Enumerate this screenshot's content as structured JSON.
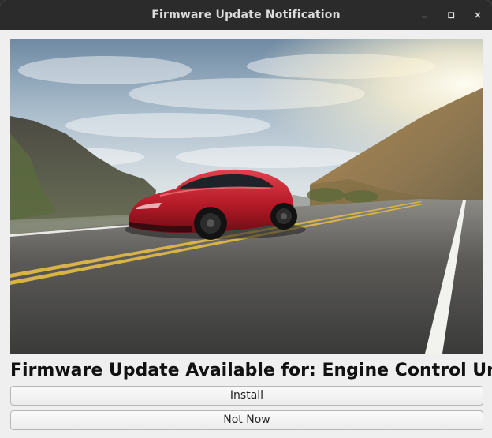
{
  "window": {
    "title": "Firmware Update Notification"
  },
  "icons": {
    "minimize": "minimize-icon",
    "maximize": "maximize-icon",
    "close": "close-icon"
  },
  "content": {
    "image": "red sports car driving on a mountain road",
    "headline": "Firmware Update Available for: Engine Control Unit"
  },
  "actions": {
    "install_label": "Install",
    "not_now_label": "Not Now"
  }
}
